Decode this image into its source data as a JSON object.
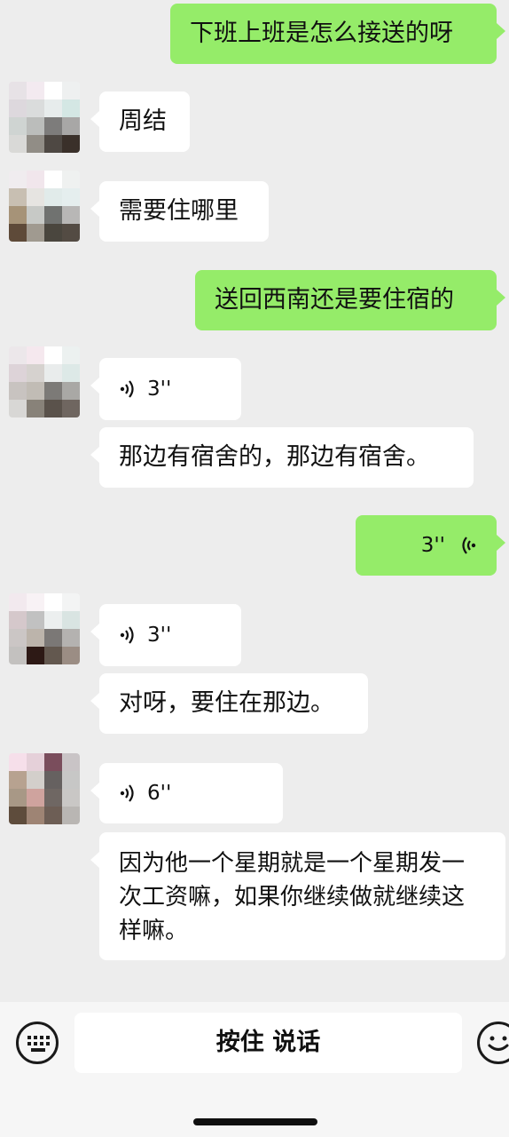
{
  "messages": [
    {
      "side": "right",
      "type": "text",
      "text": "下班上班是怎么接送的呀"
    },
    {
      "side": "left",
      "type": "text",
      "text": "周结"
    },
    {
      "side": "left",
      "type": "text",
      "text": "需要住哪里"
    },
    {
      "side": "right",
      "type": "text",
      "text": "送回西南还是要住宿的"
    },
    {
      "side": "left",
      "type": "voice",
      "duration": "3''"
    },
    {
      "side": "left",
      "type": "text",
      "text": "那边有宿舍的，那边有宿舍。"
    },
    {
      "side": "right",
      "type": "voice",
      "duration": "3''"
    },
    {
      "side": "left",
      "type": "voice",
      "duration": "3''"
    },
    {
      "side": "left",
      "type": "text",
      "text": "对呀，要住在那边。"
    },
    {
      "side": "left",
      "type": "voice",
      "duration": "6''"
    },
    {
      "side": "left",
      "type": "text",
      "text": "因为他一个星期就是一个星期发一次工资嘛，如果你继续做就继续这样嘛。"
    }
  ],
  "input_bar": {
    "keyboard_icon": "keyboard-icon",
    "talk_label": "按住 说话",
    "emoji_icon": "emoji-icon"
  },
  "colors": {
    "background": "#ededed",
    "sent_bubble": "#95ec69",
    "received_bubble": "#ffffff"
  }
}
